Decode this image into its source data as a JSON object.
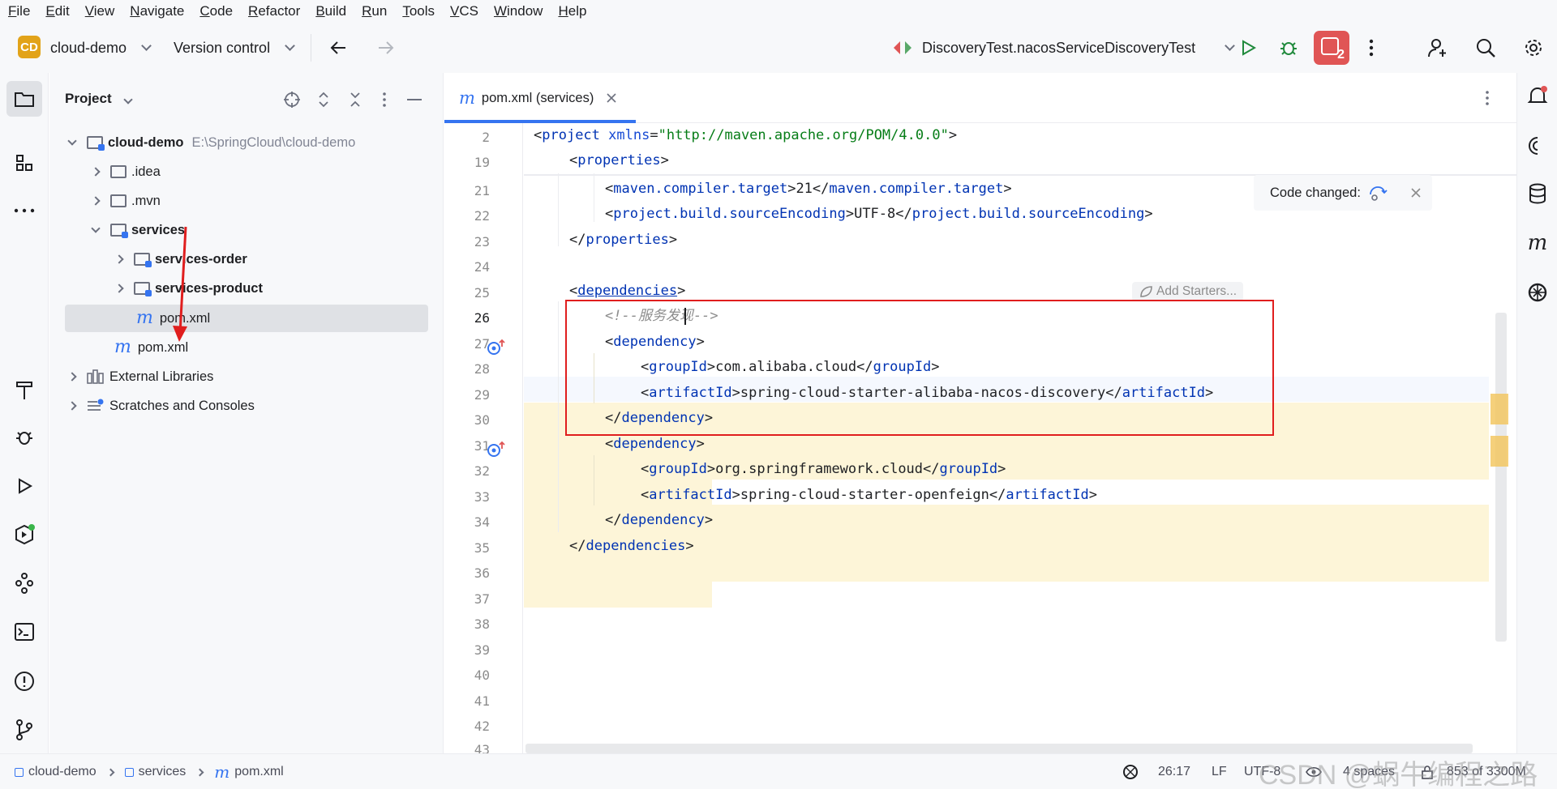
{
  "menu": [
    "File",
    "Edit",
    "View",
    "Navigate",
    "Code",
    "Refactor",
    "Build",
    "Run",
    "Tools",
    "VCS",
    "Window",
    "Help"
  ],
  "toolbar": {
    "project_badge": "CD",
    "project_name": "cloud-demo",
    "vcs": "Version control",
    "run_config": "DiscoveryTest.nacosServiceDiscoveryTest",
    "problems_count": "2"
  },
  "project_panel": {
    "title": "Project",
    "tree": [
      {
        "label": "cloud-demo",
        "path": "E:\\SpringCloud\\cloud-demo"
      },
      {
        "label": ".idea"
      },
      {
        "label": ".mvn"
      },
      {
        "label": "services"
      },
      {
        "label": "services-order"
      },
      {
        "label": "services-product"
      },
      {
        "label": "pom.xml"
      },
      {
        "label": "pom.xml"
      },
      {
        "label": "External Libraries"
      },
      {
        "label": "Scratches and Consoles"
      }
    ]
  },
  "editor": {
    "tab_label": "pom.xml (services)",
    "popup": "Code changed:",
    "inlay": "Add Starters...",
    "line_numbers": [
      "2",
      "19",
      "21",
      "22",
      "23",
      "24",
      "25",
      "26",
      "27",
      "28",
      "29",
      "30",
      "31",
      "32",
      "33",
      "34",
      "35",
      "36",
      "37",
      "38",
      "39",
      "40",
      "41",
      "42",
      "43"
    ],
    "code": {
      "l2_tag": "project",
      "l2_attr": "xmlns",
      "l2_val": "\"http://maven.apache.org/POM/4.0.0\"",
      "l19": "properties",
      "l21_tag": "maven.compiler.target",
      "l21_val": "21",
      "l22_tag": "project.build.sourceEncoding",
      "l22_val": "UTF-8",
      "l23": "properties",
      "l25": "dependencies",
      "l26": "<!--服务发现-->",
      "dep": "dependency",
      "group": "groupId",
      "artifact": "artifactId",
      "g1": "com.alibaba.cloud",
      "a1": "spring-cloud-starter-alibaba-nacos-discovery",
      "g2": "org.springframework.cloud",
      "a2": "spring-cloud-starter-openfeign",
      "l35": "dependencies"
    }
  },
  "breadcrumbs": [
    "cloud-demo",
    "services",
    "pom.xml"
  ],
  "status": {
    "position": "26:17",
    "line_sep": "LF",
    "encoding": "UTF-8",
    "indent": "4 spaces",
    "memory": "853 of 3300M"
  },
  "watermark": "CSDN @蜗牛编程之路",
  "colors": {
    "accent": "#3574f0",
    "highlight": "#fdf5d8",
    "annotation_box": "#e01e1e",
    "tag": "#0033b3",
    "string": "#067d17"
  }
}
